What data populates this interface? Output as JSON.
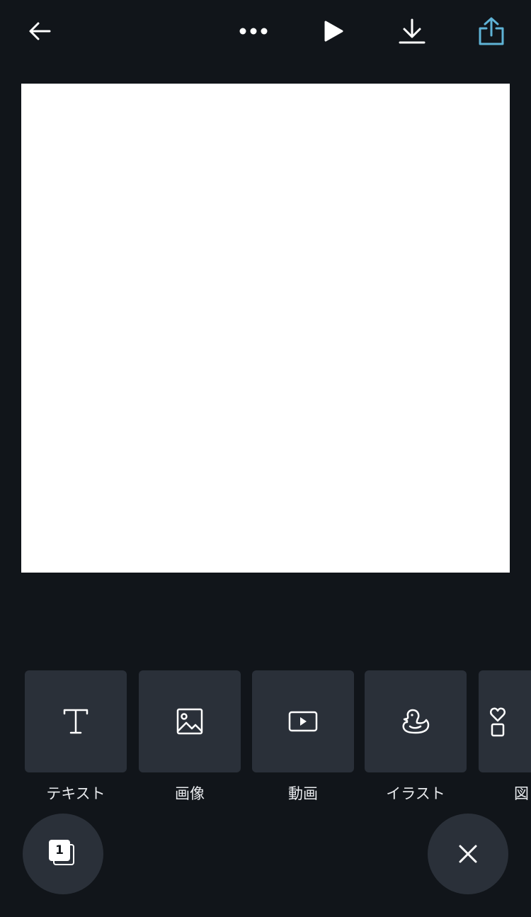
{
  "toolbar": {
    "back_icon": "arrow-left-icon",
    "more_icon": "more-horizontal-icon",
    "play_icon": "play-icon",
    "download_icon": "download-icon",
    "share_icon": "share-icon",
    "share_color": "#5fb3d6"
  },
  "canvas": {
    "background": "#ffffff"
  },
  "tray": {
    "items": [
      {
        "label": "テキスト",
        "icon": "text-icon"
      },
      {
        "label": "画像",
        "icon": "image-icon"
      },
      {
        "label": "動画",
        "icon": "video-icon"
      },
      {
        "label": "イラスト",
        "icon": "duck-icon"
      },
      {
        "label": "図",
        "icon": "shapes-icon"
      }
    ]
  },
  "bottom": {
    "page_count": "1",
    "pages_icon": "pages-icon",
    "close_icon": "close-icon"
  },
  "colors": {
    "background": "#11151a",
    "tile": "#2a3039",
    "accent": "#5fb3d6"
  }
}
